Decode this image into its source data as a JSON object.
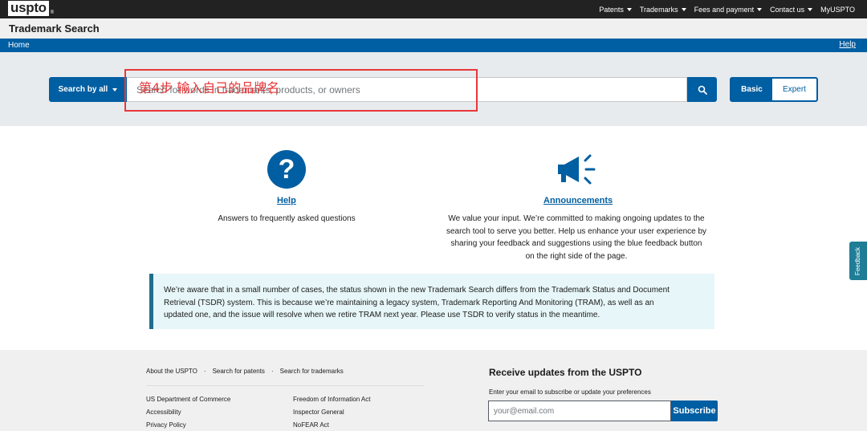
{
  "colors": {
    "primary": "#005ea2",
    "annotation": "#e8373a",
    "alert_border": "#1f6f8b"
  },
  "logo": {
    "text": "uspto",
    "mark": "®"
  },
  "topnav": {
    "items": [
      "Patents",
      "Trademarks",
      "Fees and payment",
      "Contact us",
      "MyUSPTO"
    ]
  },
  "header": {
    "title": "Trademark Search"
  },
  "bluenav": {
    "home": "Home",
    "help": "Help"
  },
  "search": {
    "by_label": "Search by all",
    "placeholder": "Search for words in trademarks, products, or owners",
    "mode_basic": "Basic",
    "mode_expert": "Expert"
  },
  "annotation": {
    "text": "第4步 输入自己的品牌名"
  },
  "cards": {
    "help": {
      "title": "Help",
      "text": "Answers to frequently asked questions"
    },
    "announcements": {
      "title": "Announcements",
      "lines": [
        "We value your input. We’re committed to making ongoing updates to the",
        "search tool to serve you better. Help us enhance your user experience by",
        "sharing your feedback and suggestions using the blue feedback button",
        "on the right side of the page."
      ]
    }
  },
  "alert": {
    "lines": [
      "We’re aware that in a small number of cases, the status shown in the new Trademark Search differs from the Trademark Status and Document",
      "Retrieval (TSDR) system. This is because we’re maintaining a legacy system, Trademark Reporting And Monitoring (TRAM), as well as an",
      "updated one, and the issue will resolve when we retire TRAM next year. Please use TSDR to verify status in the meantime."
    ]
  },
  "footer": {
    "toplinks": [
      "About the USPTO",
      "Search for patents",
      "Search for trademarks"
    ],
    "separator": "·",
    "col1": [
      "US Department of Commerce",
      "Accessibility",
      "Privacy Policy"
    ],
    "col2": [
      "Freedom of Information Act",
      "Inspector General",
      "NoFEAR Act"
    ],
    "updates_title": "Receive updates from the USPTO",
    "updates_sub": "Enter your email to subscribe or update your preferences",
    "email_placeholder": "your@email.com",
    "subscribe": "Subscribe"
  },
  "feedback": {
    "label": "Feedback"
  }
}
